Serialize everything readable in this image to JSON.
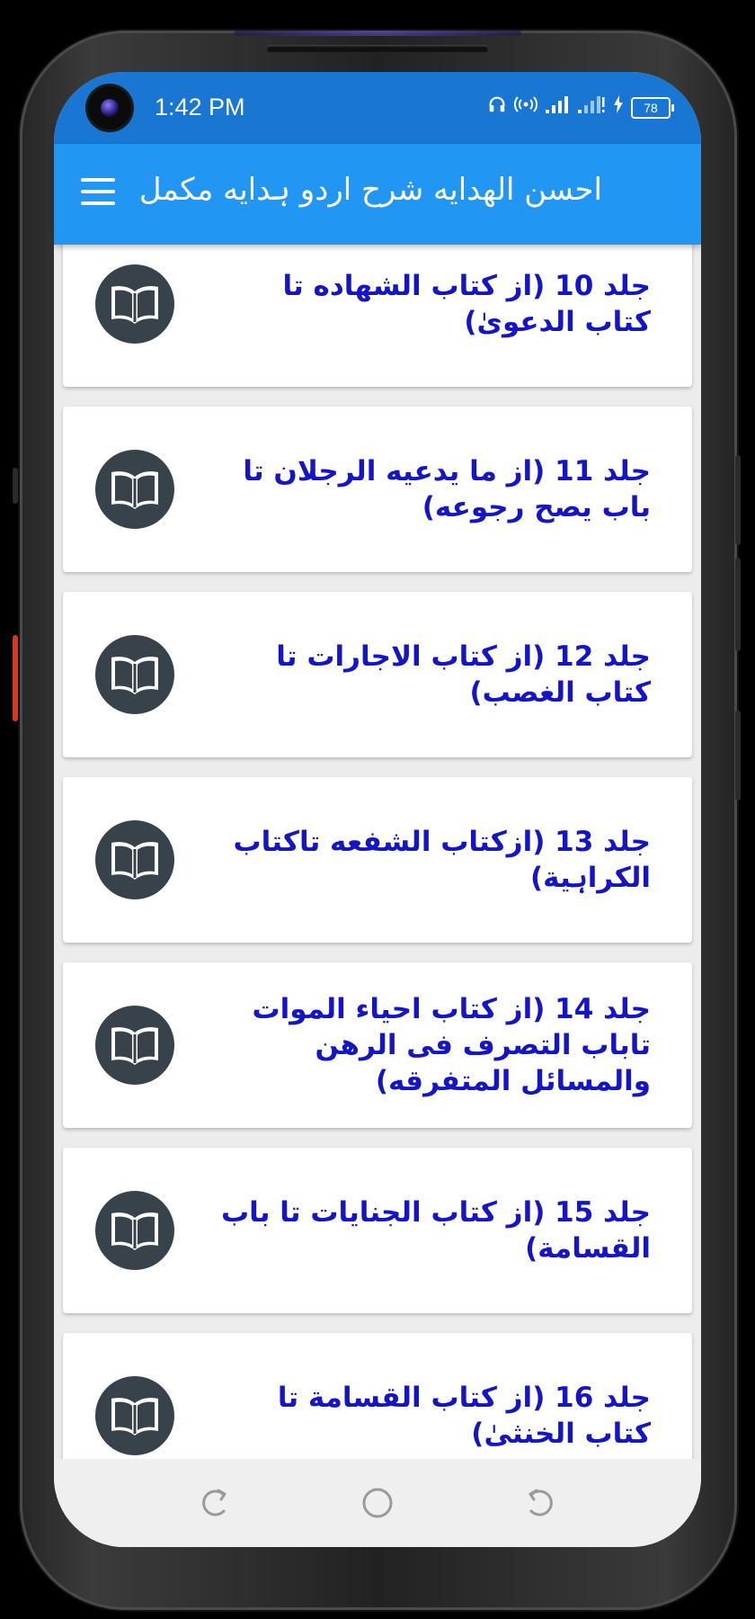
{
  "status_bar": {
    "time": "1:42 PM",
    "battery": "78",
    "icons": [
      "headphones-icon",
      "hotspot-icon",
      "signal-1-icon",
      "signal-2-icon",
      "charging-icon",
      "battery-icon"
    ]
  },
  "app_bar": {
    "title": "احسن الهدایه شرح اردو ہدایه مکمل",
    "menu_icon": "hamburger-menu-icon"
  },
  "list": {
    "items": [
      {
        "label": "جلد 10 (از کتاب الشهاده تا کتاب الدعویٰ)",
        "icon": "book-icon"
      },
      {
        "label": "جلد 11 (از ما یدعیه الرجلان تا باب یصح رجوعه)",
        "icon": "book-icon"
      },
      {
        "label": "جلد 12 (از کتاب الاجارات تا کتاب الغصب)",
        "icon": "book-icon"
      },
      {
        "label": "جلد 13 (ازکتاب الشفعه تاکتاب الکراہیة)",
        "icon": "book-icon"
      },
      {
        "label": "جلد 14 (از کتاب احیاء الموات تاباب التصرف فی الرهن والمسائل المتفرقه)",
        "icon": "book-icon"
      },
      {
        "label": "جلد 15 (از کتاب الجنایات تا باب القسامة)",
        "icon": "book-icon"
      },
      {
        "label": "جلد 16 (از کتاب القسامة تا کتاب الخنثیٰ)",
        "icon": "book-icon"
      }
    ]
  },
  "colors": {
    "status_bar": "#1976d2",
    "app_bar": "#2196f3",
    "item_text": "#1515c8",
    "icon_circle": "#37424b",
    "background": "#ececec"
  },
  "nav_bar": {
    "icons": [
      "recent-apps-icon",
      "home-icon",
      "back-icon"
    ]
  }
}
